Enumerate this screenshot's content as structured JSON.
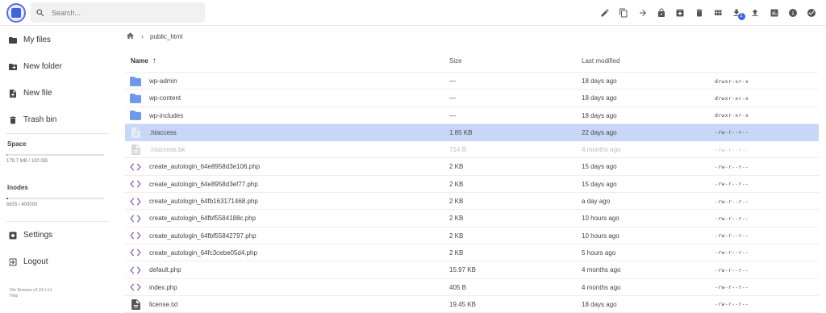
{
  "header": {
    "search_placeholder": "Search...",
    "toolbar": [
      "pencil-icon",
      "copy-icon",
      "arrow-right-icon",
      "lock-icon",
      "archive-icon",
      "trash-icon",
      "grid-view-icon",
      "download-icon",
      "upload-icon",
      "chart-icon",
      "info-icon",
      "check-circle-icon"
    ],
    "download_badge": "1"
  },
  "sidebar": {
    "items_top": [
      {
        "label": "My files",
        "icon": "folder-icon"
      },
      {
        "label": "New folder",
        "icon": "new-folder-icon"
      },
      {
        "label": "New file",
        "icon": "new-file-icon"
      },
      {
        "label": "Trash bin",
        "icon": "trash-icon"
      }
    ],
    "space": {
      "label": "Space",
      "text": "179.7 MB / 100 GB",
      "fraction": 0.0018
    },
    "inodes": {
      "label": "Inodes",
      "text": "6835 / 400000",
      "fraction": 0.017
    },
    "items_bottom": [
      {
        "label": "Settings",
        "icon": "settings-icon"
      },
      {
        "label": "Logout",
        "icon": "logout-icon"
      }
    ],
    "footer": [
      "File Browser v2.24.1-k1",
      "Help"
    ]
  },
  "breadcrumb": {
    "folder": "public_html"
  },
  "list": {
    "headers": {
      "name": "Name",
      "size": "Size",
      "modified": "Last modified"
    },
    "rows": [
      {
        "type": "folder",
        "name": "wp-admin",
        "size": "—",
        "modified": "18 days ago",
        "perm": "drwxr-xr-x"
      },
      {
        "type": "folder",
        "name": "wp-content",
        "size": "—",
        "modified": "18 days ago",
        "perm": "drwxr-xr-x"
      },
      {
        "type": "folder",
        "name": "wp-includes",
        "size": "—",
        "modified": "18 days ago",
        "perm": "drwxr-xr-x"
      },
      {
        "type": "file",
        "name": ".htaccess",
        "size": "1.85 KB",
        "modified": "22 days ago",
        "perm": "-rw-r--r--",
        "selected": true
      },
      {
        "type": "file",
        "name": ".htaccess.bk",
        "size": "714 B",
        "modified": "4 months ago",
        "perm": "-rw-r--r--",
        "dim": true
      },
      {
        "type": "code",
        "name": "create_autologin_64e8958d3e106.php",
        "size": "2 KB",
        "modified": "15 days ago",
        "perm": "-rw-r--r--"
      },
      {
        "type": "code",
        "name": "create_autologin_64e8958d3ef77.php",
        "size": "2 KB",
        "modified": "15 days ago",
        "perm": "-rw-r--r--"
      },
      {
        "type": "code",
        "name": "create_autologin_64fb163171468.php",
        "size": "2 KB",
        "modified": "a day ago",
        "perm": "-rw-r--r--"
      },
      {
        "type": "code",
        "name": "create_autologin_64fbf5584188c.php",
        "size": "2 KB",
        "modified": "10 hours ago",
        "perm": "-rw-r--r--"
      },
      {
        "type": "code",
        "name": "create_autologin_64fbf55842797.php",
        "size": "2 KB",
        "modified": "10 hours ago",
        "perm": "-rw-r--r--"
      },
      {
        "type": "code",
        "name": "create_autologin_64fc3cebe05d4.php",
        "size": "2 KB",
        "modified": "5 hours ago",
        "perm": "-rw-r--r--"
      },
      {
        "type": "code",
        "name": "default.php",
        "size": "15.97 KB",
        "modified": "4 months ago",
        "perm": "-rw-r--r--"
      },
      {
        "type": "code",
        "name": "index.php",
        "size": "405 B",
        "modified": "4 months ago",
        "perm": "-rw-r--r--"
      },
      {
        "type": "text",
        "name": "license.txt",
        "size": "19.45 KB",
        "modified": "18 days ago",
        "perm": "-rw-r--r--"
      }
    ]
  }
}
